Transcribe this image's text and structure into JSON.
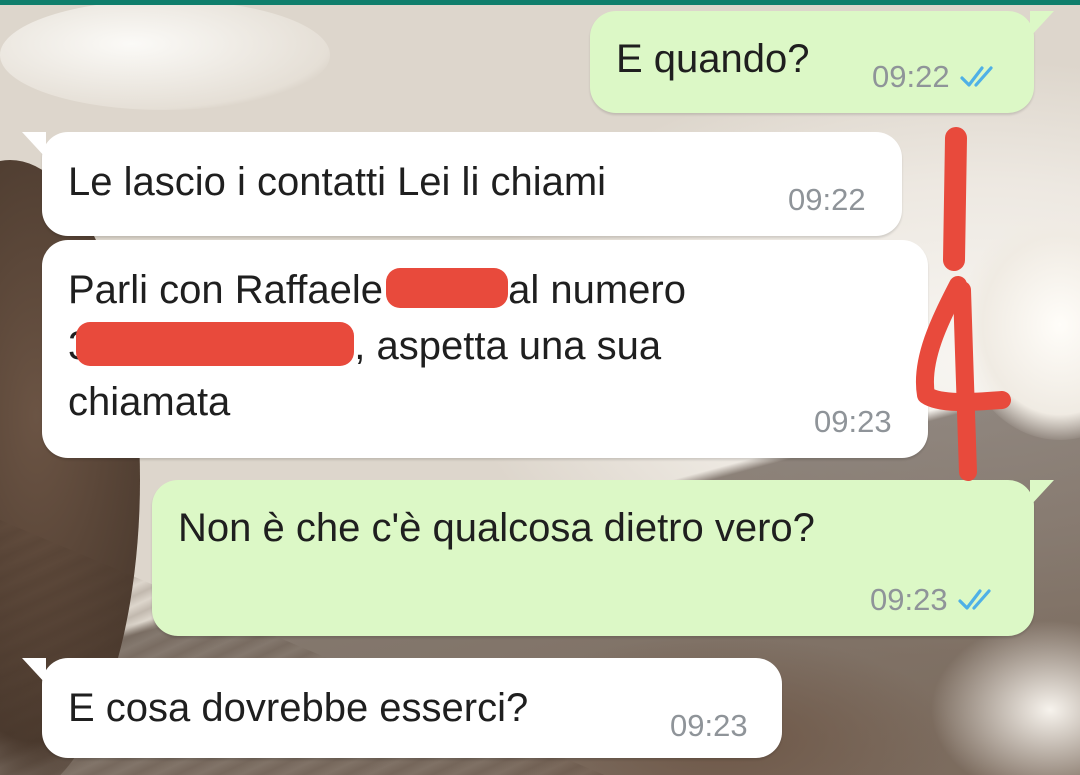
{
  "theme": {
    "incoming_bubble": "#ffffff",
    "outgoing_bubble": "#dcf8c6",
    "timestamp_color": "#8f9499",
    "read_tick_color": "#4fb0e6",
    "redaction_color": "#e84a3c",
    "annotation_color": "#e84a3c",
    "header_strip": "#0f7e6c"
  },
  "messages": [
    {
      "direction": "outgoing",
      "text": "E quando?",
      "time": "09:22",
      "status_icon": "double-check-read-icon"
    },
    {
      "direction": "incoming",
      "text": "Le lascio i contatti Lei li chiami",
      "time": "09:22"
    },
    {
      "direction": "incoming",
      "text_parts": [
        "Parli con Raffaele ",
        "al numero",
        "3",
        ", aspetta una sua",
        "chiamata"
      ],
      "redacted_segments": 2,
      "time": "09:23"
    },
    {
      "direction": "outgoing",
      "text": "Non è che c'è qualcosa dietro vero?",
      "time": "09:23",
      "status_icon": "double-check-read-icon"
    },
    {
      "direction": "incoming",
      "text": "E cosa dovrebbe esserci?",
      "time": "09:23"
    }
  ],
  "annotation": {
    "text": "4",
    "icon": "handwritten-line-and-number"
  }
}
